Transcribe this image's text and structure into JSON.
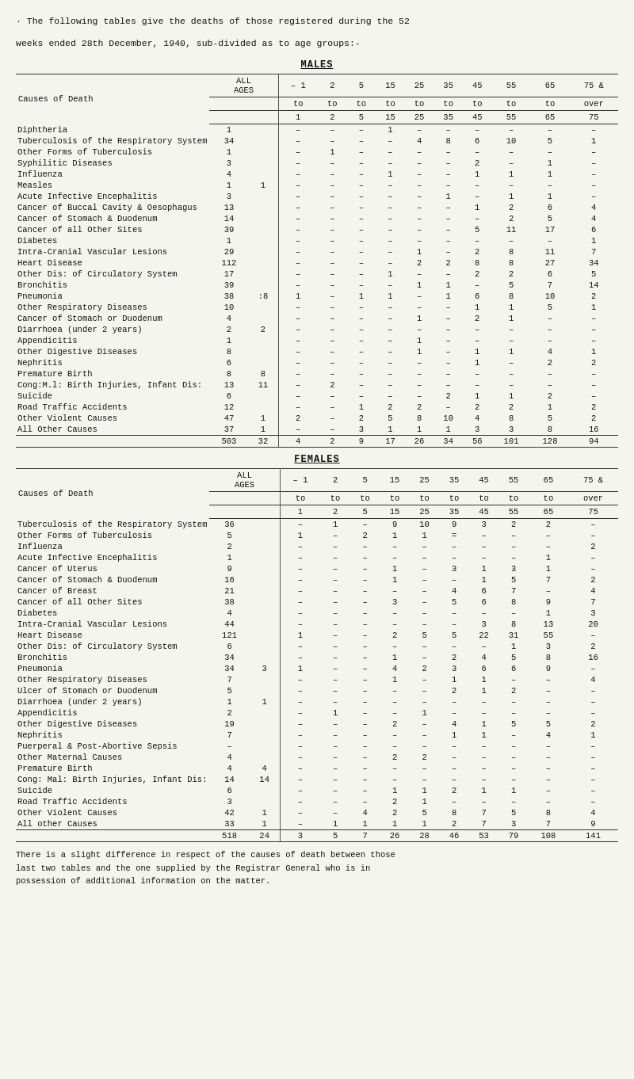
{
  "intro": {
    "line1": "· The following tables give the deaths of those registered during the 52",
    "line2": "weeks ended 28th December, 1940, sub-divided as to age groups:-"
  },
  "males": {
    "section_title": "MALES",
    "headers": {
      "col_cause": "Causes of Death",
      "col_all_label": "ALL",
      "col_ages_label": "AGES",
      "age_groups": [
        "1",
        "2",
        "5",
        "15",
        "25",
        "35",
        "45",
        "55",
        "65",
        "75 &"
      ],
      "age_row1": [
        "- 1",
        "2",
        "5",
        "15",
        "25",
        "35",
        "45",
        "55",
        "65",
        "75 &"
      ],
      "age_row2_prefix": "to to to to to to to to to to",
      "age_row3": [
        "1",
        "2",
        "5",
        "15",
        "25",
        "35",
        "45",
        "55",
        "65",
        "75"
      ],
      "over": "over"
    },
    "rows": [
      {
        "cause": "Diphtheria",
        "all": "1",
        "vals": [
          "–",
          "–",
          "–",
          "1",
          "–",
          "–",
          "–",
          "–",
          "–",
          "–"
        ]
      },
      {
        "cause": "Tuberculosis of the Respiratory System",
        "all": "34",
        "vals": [
          "–",
          "–",
          "–",
          "–",
          "4",
          "8",
          "6",
          "10",
          "5",
          "1"
        ]
      },
      {
        "cause": "Other Forms of Tuberculosis",
        "all": "1",
        "vals": [
          "–",
          "1",
          "–",
          "–",
          "–",
          "–",
          "–",
          "–",
          "–",
          "–"
        ]
      },
      {
        "cause": "Syphilitic Diseases",
        "all": "3",
        "vals": [
          "–",
          "–",
          "–",
          "–",
          "–",
          "–",
          "2",
          "–",
          "1",
          "–"
        ]
      },
      {
        "cause": "Influenza",
        "all": "4",
        "vals": [
          "–",
          "–",
          "–",
          "1",
          "–",
          "–",
          "1",
          "1",
          "1",
          "–"
        ]
      },
      {
        "cause": "Measles",
        "all": "1 1",
        "vals": [
          "–",
          "–",
          "–",
          "–",
          "–",
          "–",
          "–",
          "–",
          "–",
          "–"
        ]
      },
      {
        "cause": "Acute Infective Encephalitis",
        "all": "3",
        "vals": [
          "–",
          "–",
          "–",
          "–",
          "–",
          "1",
          "–",
          "1",
          "1",
          "–"
        ]
      },
      {
        "cause": "Cancer of Buccal Cavity & Oesophagus",
        "all": "13",
        "vals": [
          "–",
          "–",
          "–",
          "–",
          "–",
          "–",
          "1",
          "2",
          "6",
          "4"
        ]
      },
      {
        "cause": "Cancer of Stomach & Duodenum",
        "all": "14",
        "vals": [
          "–",
          "–",
          "–",
          "–",
          "–",
          "–",
          "–",
          "2",
          "5",
          "4"
        ]
      },
      {
        "cause": "Cancer of all Other Sites",
        "all": "39",
        "vals": [
          "–",
          "–",
          "–",
          "–",
          "–",
          "–",
          "5",
          "11",
          "17",
          "6"
        ]
      },
      {
        "cause": "Diabetes",
        "all": "1",
        "vals": [
          "–",
          "–",
          "–",
          "–",
          "–",
          "–",
          "–",
          "–",
          "–",
          "1"
        ]
      },
      {
        "cause": "Intra-Cranial Vascular Lesions",
        "all": "29",
        "vals": [
          "–",
          "–",
          "–",
          "–",
          "1",
          "–",
          "2",
          "8",
          "11",
          "7"
        ]
      },
      {
        "cause": "Heart Disease",
        "all": "112",
        "vals": [
          "–",
          "–",
          "–",
          "–",
          "2",
          "2",
          "8",
          "8",
          "27",
          "34"
        ]
      },
      {
        "cause": "Other Dis: of Circulatory System",
        "all": "17",
        "vals": [
          "–",
          "–",
          "–",
          "1",
          "–",
          "–",
          "2",
          "2",
          "6",
          "5"
        ]
      },
      {
        "cause": "Bronchitis",
        "all": "39",
        "vals": [
          "–",
          "–",
          "–",
          "–",
          "1",
          "1",
          "–",
          "5",
          "7",
          "14"
        ]
      },
      {
        "cause": "Pneumonia",
        "all": "38 :8",
        "vals": [
          "1",
          "–",
          "1",
          "1",
          "–",
          "1",
          "6",
          "8",
          "10",
          "2"
        ]
      },
      {
        "cause": "Other Respiratory Diseases",
        "all": "10",
        "vals": [
          "–",
          "–",
          "–",
          "–",
          "–",
          "–",
          "1",
          "1",
          "5",
          "1"
        ]
      },
      {
        "cause": "Cancer of Stomach or Duodenum",
        "all": "4",
        "vals": [
          "–",
          "–",
          "–",
          "–",
          "1",
          "–",
          "2",
          "1",
          "–",
          "–"
        ]
      },
      {
        "cause": "Diarrhoea (under 2 years)",
        "all": "2 2",
        "vals": [
          "–",
          "–",
          "–",
          "–",
          "–",
          "–",
          "–",
          "–",
          "–",
          "–"
        ]
      },
      {
        "cause": "Appendicitis",
        "all": "1",
        "vals": [
          "–",
          "–",
          "–",
          "–",
          "1",
          "–",
          "–",
          "–",
          "–",
          "–"
        ]
      },
      {
        "cause": "Other Digestive Diseases",
        "all": "8",
        "vals": [
          "–",
          "–",
          "–",
          "–",
          "1",
          "–",
          "1",
          "1",
          "4",
          "1"
        ]
      },
      {
        "cause": "Nephritis",
        "all": "6",
        "vals": [
          "–",
          "–",
          "–",
          "–",
          "–",
          "–",
          "1",
          "–",
          "2",
          "2"
        ]
      },
      {
        "cause": "Premature Birth",
        "all": "8 8",
        "vals": [
          "–",
          "–",
          "–",
          "–",
          "–",
          "–",
          "–",
          "–",
          "–",
          "–"
        ]
      },
      {
        "cause": "Cong:M.l: Birth Injuries, Infant Dis:",
        "all": "13 11",
        "vals": [
          "–",
          "2",
          "–",
          "–",
          "–",
          "–",
          "–",
          "–",
          "–",
          "–"
        ]
      },
      {
        "cause": "Suicide",
        "all": "6",
        "vals": [
          "–",
          "–",
          "–",
          "–",
          "–",
          "2",
          "1",
          "1",
          "2",
          "–"
        ]
      },
      {
        "cause": "Road Traffic Accidents",
        "all": "12",
        "vals": [
          "–",
          "–",
          "1",
          "2",
          "2",
          "–",
          "2",
          "2",
          "1",
          "2"
        ]
      },
      {
        "cause": "Other Violent Causes",
        "all": "47 1",
        "vals": [
          "2",
          "–",
          "2",
          "5",
          "8",
          "10",
          "4",
          "8",
          "5",
          "2"
        ]
      },
      {
        "cause": "All Other Causes",
        "all": "37 1",
        "vals": [
          "–",
          "–",
          "3",
          "1",
          "1",
          "1",
          "3",
          "3",
          "8",
          "16"
        ]
      }
    ],
    "totals": {
      "all": "503 32",
      "vals": [
        "4",
        "2",
        "9",
        "17",
        "26",
        "34",
        "56",
        "101",
        "128",
        "94"
      ]
    }
  },
  "females": {
    "section_title": "FEMALES",
    "rows": [
      {
        "cause": "Tuberculosis of the Respiratory System",
        "all": "36",
        "vals": [
          "–",
          "1",
          "–",
          "9",
          "10",
          "9",
          "3",
          "2",
          "2",
          "–"
        ]
      },
      {
        "cause": "Other Forms of Tuberculosis",
        "all": "5",
        "vals": [
          "1",
          "–",
          "2",
          "1",
          "1",
          "=",
          "–",
          "–",
          "–",
          "–"
        ]
      },
      {
        "cause": "Influenza",
        "all": "2",
        "vals": [
          "–",
          "–",
          "–",
          "–",
          "–",
          "–",
          "–",
          "–",
          "–",
          "2"
        ]
      },
      {
        "cause": "Acute Infective Encephalitis",
        "all": "1",
        "vals": [
          "–",
          "–",
          "–",
          "–",
          "–",
          "–",
          "–",
          "–",
          "1",
          "–"
        ]
      },
      {
        "cause": "Cancer of Uterus",
        "all": "9",
        "vals": [
          "–",
          "–",
          "–",
          "1",
          "–",
          "3",
          "1",
          "3",
          "1",
          "–"
        ]
      },
      {
        "cause": "Cancer of Stomach & Duodenum",
        "all": "16",
        "vals": [
          "–",
          "–",
          "–",
          "1",
          "–",
          "–",
          "1",
          "5",
          "7",
          "2"
        ]
      },
      {
        "cause": "Cancer of Breast",
        "all": "21",
        "vals": [
          "–",
          "–",
          "–",
          "–",
          "–",
          "4",
          "6",
          "7",
          "–",
          "4"
        ]
      },
      {
        "cause": "Cancer of all Other Sites",
        "all": "38",
        "vals": [
          "–",
          "–",
          "–",
          "3",
          "–",
          "5",
          "6",
          "8",
          "9",
          "7"
        ]
      },
      {
        "cause": "Diabetes",
        "all": "4",
        "vals": [
          "–",
          "–",
          "–",
          "–",
          "–",
          "–",
          "–",
          "–",
          "1",
          "3"
        ]
      },
      {
        "cause": "Intra-Cranial Vascular Lesions",
        "all": "44",
        "vals": [
          "–",
          "–",
          "–",
          "–",
          "–",
          "–",
          "3",
          "8",
          "13",
          "20"
        ]
      },
      {
        "cause": "Heart Disease",
        "all": "121",
        "vals": [
          "1",
          "–",
          "–",
          "2",
          "5",
          "5",
          "22",
          "31",
          "55",
          "–"
        ]
      },
      {
        "cause": "Other Dis: of Circulatory System",
        "all": "6",
        "vals": [
          "–",
          "–",
          "–",
          "–",
          "–",
          "–",
          "–",
          "1",
          "3",
          "2"
        ]
      },
      {
        "cause": "Bronchitis",
        "all": "34",
        "vals": [
          "–",
          "–",
          "–",
          "1",
          "–",
          "2",
          "4",
          "5",
          "8",
          "16"
        ]
      },
      {
        "cause": "Pneumonia",
        "all": "34 3",
        "vals": [
          "1",
          "–",
          "–",
          "4",
          "2",
          "3",
          "6",
          "6",
          "9",
          "–"
        ]
      },
      {
        "cause": "Other Respiratory Diseases",
        "all": "7",
        "vals": [
          "–",
          "–",
          "–",
          "1",
          "–",
          "1",
          "1",
          "–",
          "–",
          "4"
        ]
      },
      {
        "cause": "Ulcer of Stomach or Duodenum",
        "all": "5",
        "vals": [
          "–",
          "–",
          "–",
          "–",
          "–",
          "2",
          "1",
          "2",
          "–",
          "–"
        ]
      },
      {
        "cause": "Diarrhoea (under 2 years)",
        "all": "1 1",
        "vals": [
          "–",
          "–",
          "–",
          "–",
          "–",
          "–",
          "–",
          "–",
          "–",
          "–"
        ]
      },
      {
        "cause": "Appendicitis",
        "all": "2",
        "vals": [
          "–",
          "1",
          "–",
          "–",
          "1",
          "–",
          "–",
          "–",
          "–",
          "–"
        ]
      },
      {
        "cause": "Other Digestive Diseases",
        "all": "19",
        "vals": [
          "–",
          "–",
          "–",
          "2",
          "–",
          "4",
          "1",
          "5",
          "5",
          "2"
        ]
      },
      {
        "cause": "Nephritis",
        "all": "7",
        "vals": [
          "–",
          "–",
          "–",
          "–",
          "–",
          "1",
          "1",
          "–",
          "4",
          "1"
        ]
      },
      {
        "cause": "Puerperal & Post-Abortive Sepsis",
        "all": "–",
        "vals": [
          "–",
          "–",
          "–",
          "–",
          "–",
          "–",
          "–",
          "–",
          "–",
          "–"
        ]
      },
      {
        "cause": "Other Maternal Causes",
        "all": "4",
        "vals": [
          "–",
          "–",
          "–",
          "2",
          "2",
          "–",
          "–",
          "–",
          "–",
          "–"
        ]
      },
      {
        "cause": "Premature Birth",
        "all": "4 4",
        "vals": [
          "–",
          "–",
          "–",
          "–",
          "–",
          "–",
          "–",
          "–",
          "–",
          "–"
        ]
      },
      {
        "cause": "Cong: Mal: Birth Injuries, Infant Dis:",
        "all": "14 14",
        "vals": [
          "–",
          "–",
          "–",
          "–",
          "–",
          "–",
          "–",
          "–",
          "–",
          "–"
        ]
      },
      {
        "cause": "Suicide",
        "all": "6",
        "vals": [
          "–",
          "–",
          "–",
          "1",
          "1",
          "2",
          "1",
          "1",
          "–",
          "–"
        ]
      },
      {
        "cause": "Road Traffic Accidents",
        "all": "3",
        "vals": [
          "–",
          "–",
          "–",
          "2",
          "1",
          "–",
          "–",
          "–",
          "–",
          "–"
        ]
      },
      {
        "cause": "Other Violent Causes",
        "all": "42 1",
        "vals": [
          "–",
          "–",
          "4",
          "2",
          "5",
          "8",
          "7",
          "5",
          "8",
          "4"
        ]
      },
      {
        "cause": "All other Causes",
        "all": "33 1",
        "vals": [
          "–",
          "1",
          "1",
          "1",
          "1",
          "2",
          "7",
          "3",
          "7",
          "9"
        ]
      }
    ],
    "totals": {
      "all": "518 24",
      "vals": [
        "3",
        "5",
        "7",
        "26",
        "28",
        "46",
        "53",
        "79",
        "108",
        "141"
      ]
    }
  },
  "footnote": {
    "lines": [
      "There is a slight difference in respect of the causes of death between those",
      "last two tables and the one supplied by the Registrar General who is in",
      "possession of additional information on the matter."
    ]
  }
}
